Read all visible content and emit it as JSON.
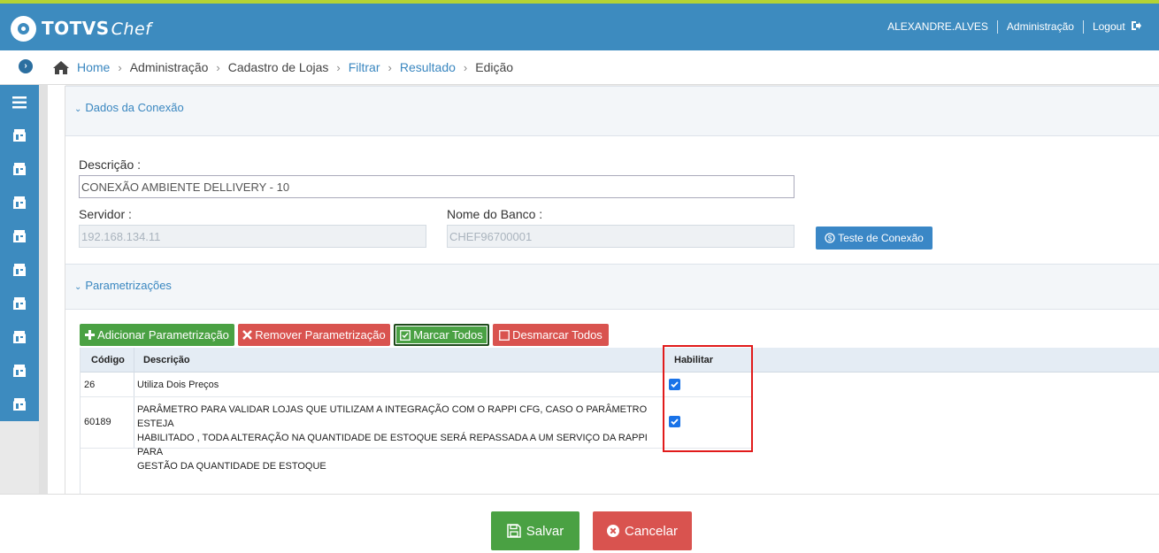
{
  "brand": {
    "name": "TOTVS",
    "product": "Chef"
  },
  "user_menu": {
    "username": "ALEXANDRE.ALVES",
    "admin": "Administração",
    "logout": "Logout"
  },
  "breadcrumb": {
    "home": "Home",
    "items": [
      "Administração",
      "Cadastro de Lojas",
      "Filtrar",
      "Resultado",
      "Edição"
    ]
  },
  "connection_panel": {
    "title": "Dados da Conexão",
    "description_label": "Descrição :",
    "description_value": "CONEXÃO AMBIENTE DELLIVERY - 10",
    "server_label": "Servidor :",
    "server_value": "192.168.134.11",
    "dbname_label": "Nome do Banco :",
    "dbname_value": "CHEF96700001",
    "test_button": "Teste de Conexão"
  },
  "params_panel": {
    "title": "Parametrizações",
    "buttons": {
      "add": "Adicionar Parametrização",
      "remove": "Remover Parametrização",
      "check_all": "Marcar Todos",
      "uncheck_all": "Desmarcar Todos"
    },
    "columns": {
      "code": "Código",
      "description": "Descrição",
      "enable": "Habilitar"
    },
    "rows": [
      {
        "code": "26",
        "description": "Utiliza Dois Preços",
        "enabled": true
      },
      {
        "code": "60189",
        "description_lines": [
          "PARÂMETRO PARA VALIDAR LOJAS QUE UTILIZAM A INTEGRAÇÃO COM O RAPPI CFG, CASO O PARÂMETRO ESTEJA",
          "HABILITADO , TODA ALTERAÇÃO NA QUANTIDADE DE ESTOQUE SERÁ REPASSADA A UM SERVIÇO DA RAPPI PARA",
          "GESTÃO DA QUANTIDADE DE ESTOQUE"
        ],
        "enabled": true
      }
    ]
  },
  "footer": {
    "save": "Salvar",
    "cancel": "Cancelar"
  },
  "colors": {
    "header": "#3d8bbf",
    "accent_line": "#b5d334",
    "link": "#3a87c0",
    "success": "#4aa143",
    "danger": "#d9534f",
    "highlight": "#e11b1b"
  },
  "icons": [
    "home-icon",
    "menu-icon",
    "store-icon",
    "logout-icon",
    "dollar-circle-icon",
    "plus-icon",
    "times-icon",
    "check-square-icon",
    "square-icon",
    "save-icon",
    "cancel-circle-icon"
  ]
}
